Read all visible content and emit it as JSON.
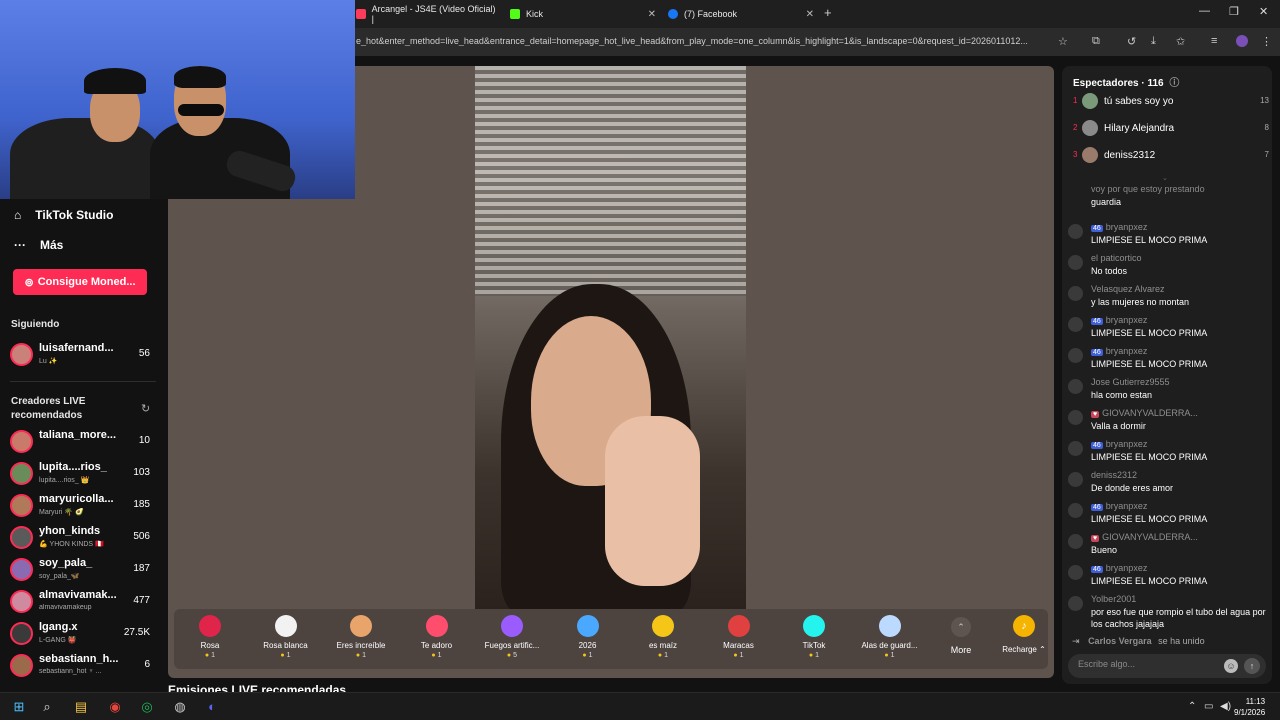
{
  "browser": {
    "tabs": [
      {
        "label": "Arcangel - JS4E (Video Oficial) |",
        "color": "#ff3b5c"
      },
      {
        "label": "Kick",
        "color": "#53fc18"
      },
      {
        "label": "(7) Facebook",
        "color": "#1877f2"
      }
    ],
    "new_tab": "+",
    "url": "e_hot&enter_method=live_head&entrance_detail=homepage_hot_live_head&from_play_mode=one_column&is_highlight=1&is_landscape=0&request_id=2026011012..."
  },
  "sidebar": {
    "tiktok_studio": "TikTok Studio",
    "more": "Más",
    "coins_button": "Consigue Moned...",
    "following_title": "Siguiendo",
    "following": [
      {
        "name": "luisafernand...",
        "sub": "Lu ✨",
        "count": "56"
      }
    ],
    "recommended_title": "Creadores LIVE recomendados",
    "recommended": [
      {
        "name": "taliana_more...",
        "sub": "",
        "count": "10"
      },
      {
        "name": "lupita....rios_",
        "sub": "lupita....rios_ 👑",
        "count": "103"
      },
      {
        "name": "maryuricolla...",
        "sub": "Maryuri 🌴 🥑",
        "count": "185"
      },
      {
        "name": "yhon_kinds",
        "sub": "💪 YHON KINDS 🇵🇪",
        "count": "506"
      },
      {
        "name": "soy_pala_",
        "sub": "soy_pala_🦋",
        "count": "187"
      },
      {
        "name": "almavivamak...",
        "sub": "almavivamakeup",
        "count": "477"
      },
      {
        "name": "lgang.x",
        "sub": "L-GANG 👹",
        "count": "27.5K"
      },
      {
        "name": "sebastiann_h...",
        "sub": "sebastiann_hot ♆ ...",
        "count": "6"
      }
    ]
  },
  "gifts": [
    {
      "name": "Rosa",
      "price": "1",
      "color": "#e0244a"
    },
    {
      "name": "Rosa blanca",
      "price": "1",
      "color": "#f2f2f2"
    },
    {
      "name": "Eres increíble",
      "price": "1",
      "color": "#e8a46b"
    },
    {
      "name": "Te adoro",
      "price": "1",
      "color": "#ff4d6d"
    },
    {
      "name": "Fuegos artific...",
      "price": "5",
      "color": "#9b5cff"
    },
    {
      "name": "2026",
      "price": "1",
      "color": "#4aa8ff"
    },
    {
      "name": "es maíz",
      "price": "1",
      "color": "#f5c518"
    },
    {
      "name": "Maracas",
      "price": "1",
      "color": "#e04040"
    },
    {
      "name": "TikTok",
      "price": "1",
      "color": "#25f4ee"
    },
    {
      "name": "Alas de guard...",
      "price": "1",
      "color": "#bcd9ff"
    }
  ],
  "gift_more": "More",
  "recharge": "Recharge",
  "recommended_streams_title": "Emisiones LIVE recomendadas",
  "chat": {
    "viewers_title": "Espectadores · 116",
    "top_viewers": [
      {
        "rank": "1",
        "name": "tú sabes soy yo",
        "count": "13"
      },
      {
        "rank": "2",
        "name": "Hilary Alejandra",
        "count": "8"
      },
      {
        "rank": "3",
        "name": "deniss2312",
        "count": "7"
      }
    ],
    "messages": [
      {
        "user": "",
        "badge": "",
        "text": "guardia"
      },
      {
        "user": "bryanpxez",
        "badge": "46",
        "text": "LIMPIESE EL MOCO PRIMA"
      },
      {
        "user": "el paticortico",
        "badge": "",
        "text": "No todos"
      },
      {
        "user": "Velasquez Alvarez",
        "badge": "",
        "text": "y las mujeres no montan"
      },
      {
        "user": "bryanpxez",
        "badge": "46",
        "text": "LIMPIESE EL MOCO PRIMA"
      },
      {
        "user": "bryanpxez",
        "badge": "46",
        "text": "LIMPIESE EL MOCO PRIMA"
      },
      {
        "user": "Jose Gutierrez9555",
        "badge": "",
        "text": "hla como estan"
      },
      {
        "user": "GIOVANYVALDERRA...",
        "badge": "♥",
        "text": "Valla a dormir"
      },
      {
        "user": "bryanpxez",
        "badge": "46",
        "text": "LIMPIESE EL MOCO PRIMA"
      },
      {
        "user": "deniss2312",
        "badge": "",
        "text": "De donde eres amor"
      },
      {
        "user": "bryanpxez",
        "badge": "46",
        "text": "LIMPIESE EL MOCO PRIMA"
      },
      {
        "user": "GIOVANYVALDERRA...",
        "badge": "♥",
        "text": "Bueno"
      },
      {
        "user": "bryanpxez",
        "badge": "46",
        "text": "LIMPIESE EL MOCO PRIMA"
      },
      {
        "user": "Yolber2001",
        "badge": "",
        "text": "por eso fue que rompio el tubo del agua por los cachos jajajaja"
      }
    ],
    "partial_top": "voy por que estoy prestando",
    "joined_user": "Carlos Vergara",
    "joined_text": "se ha unido",
    "input_placeholder": "Escribe algo..."
  },
  "taskbar": {
    "time": "11:13",
    "date": "9/1/2026"
  }
}
